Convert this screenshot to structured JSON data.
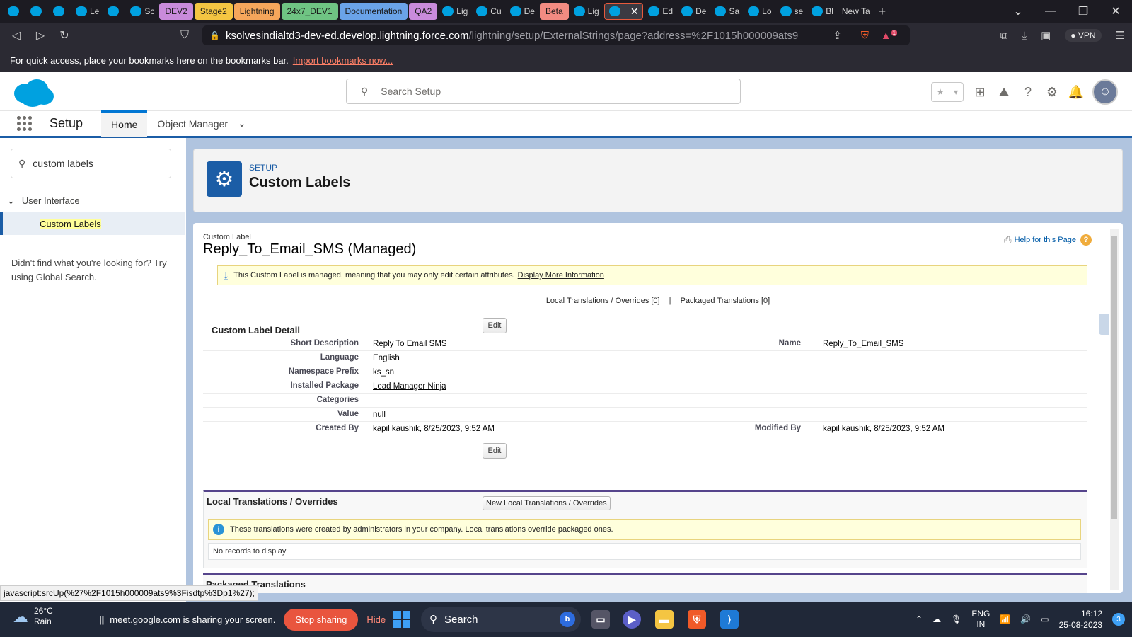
{
  "browser": {
    "tabs": [
      {
        "label": "",
        "icon": "gmail-icon"
      },
      {
        "label": "",
        "icon": "circle-icon"
      },
      {
        "label": "",
        "icon": "jira-icon"
      },
      {
        "label": "Le",
        "icon": "drive-icon"
      },
      {
        "label": "",
        "icon": "meet-icon"
      },
      {
        "label": "Sc",
        "icon": "drive-icon"
      },
      {
        "label": "DEV2",
        "color": "#c98bdb"
      },
      {
        "label": "Stage2",
        "color": "#f4c542"
      },
      {
        "label": "Lightning",
        "color": "#f5a65b"
      },
      {
        "label": "24x7_DEV1",
        "color": "#6fc483"
      },
      {
        "label": "Documentation",
        "color": "#6aa3e8"
      },
      {
        "label": "QA2",
        "color": "#c98bdb"
      },
      {
        "label": "Lig",
        "icon": "salesforce-icon"
      },
      {
        "label": "Cu",
        "icon": "salesforce-icon"
      },
      {
        "label": "De",
        "icon": "salesforce-icon"
      },
      {
        "label": "Beta",
        "color": "#f28b82"
      },
      {
        "label": "Lig",
        "icon": "salesforce-icon"
      },
      {
        "label": "",
        "icon": "salesforce-icon",
        "active": true
      },
      {
        "label": "Ed",
        "icon": "salesforce-icon"
      },
      {
        "label": "De",
        "icon": "salesforce-icon"
      },
      {
        "label": "Sa",
        "icon": "salesforce-icon"
      },
      {
        "label": "Lo",
        "icon": "circle-icon"
      },
      {
        "label": "se",
        "icon": "github-icon"
      },
      {
        "label": "Bl",
        "icon": "bookmark-icon"
      },
      {
        "label": "New Ta",
        "icon": ""
      }
    ],
    "url_host": "ksolvesindialtd3-dev-ed.develop.lightning.force.com",
    "url_path": "/lightning/setup/ExternalStrings/page?address=%2F1015h000009ats9",
    "vpn_label": "VPN",
    "shields_badge": "1",
    "bookmarks_text": "For quick access, place your bookmarks here on the bookmarks bar.",
    "bookmarks_link": "Import bookmarks now..."
  },
  "sf_header": {
    "search_placeholder": "Search Setup"
  },
  "setup_nav": {
    "title": "Setup",
    "tabs": [
      "Home",
      "Object Manager"
    ]
  },
  "left_panel": {
    "quick_find_value": "custom labels",
    "tree_parent": "User Interface",
    "tree_child": "Custom Labels",
    "not_found_text": "Didn't find what you're looking for? Try using Global Search."
  },
  "page_header": {
    "crumb": "SETUP",
    "title": "Custom Labels"
  },
  "detail": {
    "type_label": "Custom Label",
    "name_title": "Reply_To_Email_SMS (Managed)",
    "help_link": "Help for this Page",
    "managed_msg": "This Custom Label is managed, meaning that you may only edit certain attributes.",
    "managed_link": "Display More Information",
    "link_local": "Local Translations / Overrides [0]",
    "link_packaged": "Packaged Translations [0]",
    "link_sep": "|",
    "section_title": "Custom Label Detail",
    "edit_label": "Edit",
    "fields": [
      {
        "label": "Short Description",
        "value": "Reply To Email SMS",
        "label2": "Name",
        "value2": "Reply_To_Email_SMS"
      },
      {
        "label": "Language",
        "value": "English"
      },
      {
        "label": "Namespace Prefix",
        "value": "ks_sn"
      },
      {
        "label": "Installed Package",
        "value": "Lead Manager Ninja",
        "link": true
      },
      {
        "label": "Categories",
        "value": ""
      },
      {
        "label": "Value",
        "value": "null"
      },
      {
        "label": "Created By",
        "value_link": "kapil kaushik",
        "value_rest": ", 8/25/2023, 9:52 AM",
        "label2": "Modified By",
        "value2_link": "kapil kaushik",
        "value2_rest": ", 8/25/2023, 9:52 AM"
      }
    ],
    "local_title": "Local Translations / Overrides",
    "local_new_btn": "New Local Translations / Overrides",
    "local_info": "These translations were created by administrators in your company. Local translations override packaged ones.",
    "local_empty": "No records to display",
    "packaged_title": "Packaged Translations"
  },
  "status_link": "javascript:srcUp(%27%2F1015h000009ats9%3Fisdtp%3Dp1%27);",
  "taskbar": {
    "temp": "26°C",
    "weather": "Rain",
    "share_text": "meet.google.com is sharing your screen.",
    "stop_label": "Stop sharing",
    "hide_label": "Hide",
    "search_label": "Search",
    "lang_top": "ENG",
    "lang_bottom": "IN",
    "time": "16:12",
    "date": "25-08-2023",
    "notif_count": "3"
  }
}
